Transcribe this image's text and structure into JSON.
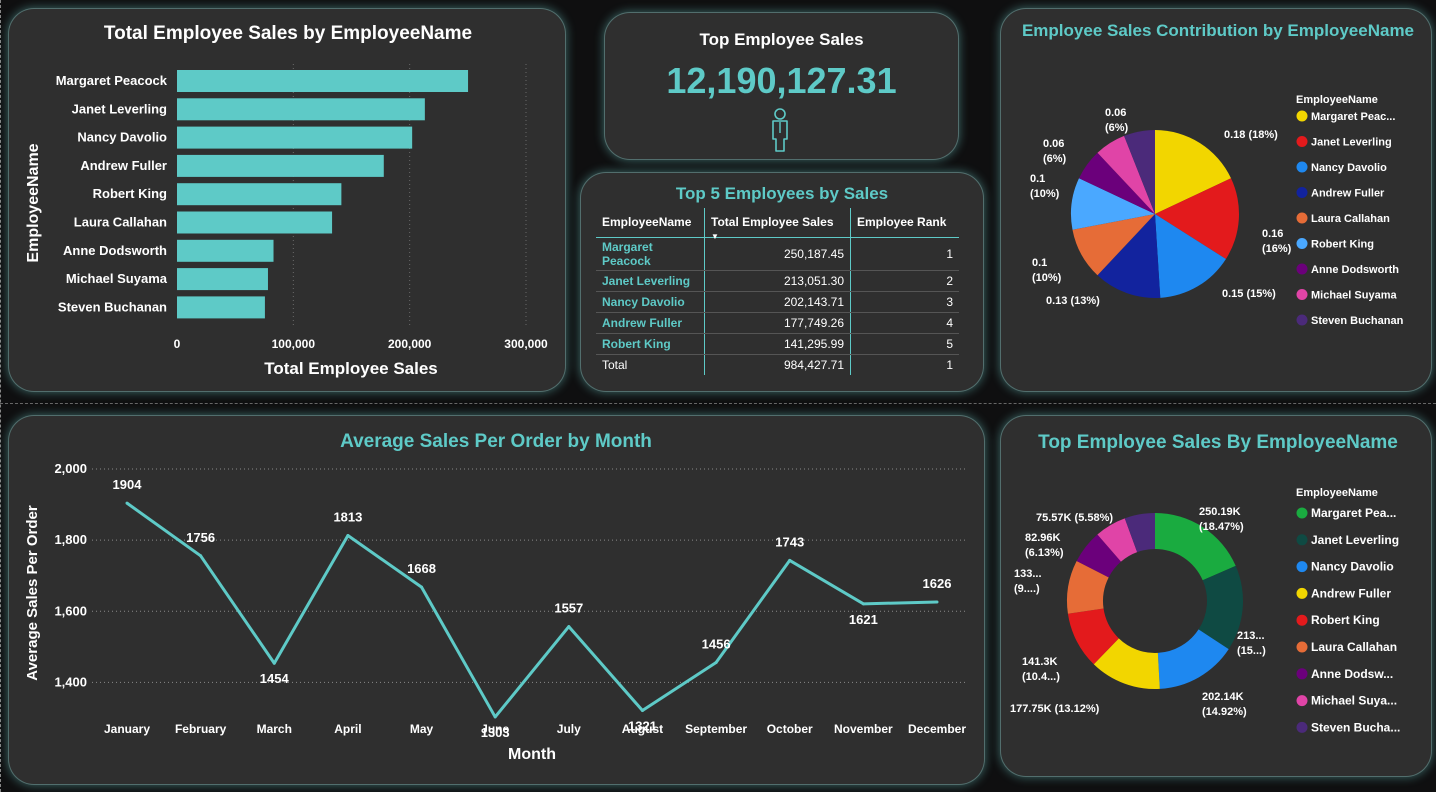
{
  "bar_card": {
    "title": "Total Employee Sales by EmployeeName",
    "xlabel": "Total Employee Sales",
    "ylabel": "EmployeeName"
  },
  "kpi_card": {
    "title": "Top Employee Sales",
    "value": "12,190,127.31",
    "icon": "person-icon"
  },
  "table_card": {
    "title": "Top 5 Employees by Sales",
    "columns": [
      "EmployeeName",
      "Total Employee Sales",
      "Employee Rank"
    ],
    "rows": [
      [
        "Margaret Peacock",
        "250,187.45",
        "1"
      ],
      [
        "Janet Leverling",
        "213,051.30",
        "2"
      ],
      [
        "Nancy Davolio",
        "202,143.71",
        "3"
      ],
      [
        "Andrew Fuller",
        "177,749.26",
        "4"
      ],
      [
        "Robert King",
        "141,295.99",
        "5"
      ]
    ],
    "total_row": [
      "Total",
      "984,427.71",
      "1"
    ]
  },
  "pie_card": {
    "title": "Employee Sales Contribution by EmployeeName",
    "legend_title": "EmployeeName"
  },
  "line_card": {
    "title": "Average Sales Per Order by Month",
    "xlabel": "Month",
    "ylabel": "Average Sales Per Order"
  },
  "donut_card": {
    "title": "Top Employee Sales By EmployeeName",
    "legend_title": "EmployeeName"
  },
  "chart_data": [
    {
      "type": "bar",
      "orientation": "horizontal",
      "title": "Total Employee Sales by EmployeeName",
      "xlabel": "Total Employee Sales",
      "ylabel": "EmployeeName",
      "categories": [
        "Margaret Peacock",
        "Janet Leverling",
        "Nancy Davolio",
        "Andrew Fuller",
        "Robert King",
        "Laura Callahan",
        "Anne Dodsworth",
        "Michael Suyama",
        "Steven Buchanan"
      ],
      "values": [
        250187,
        213051,
        202144,
        177749,
        141296,
        133301,
        82964,
        78198,
        75568
      ],
      "xlim": [
        0,
        300000
      ],
      "ticks": [
        "0",
        "100,000",
        "200,000",
        "300,000"
      ],
      "color": "#5ecac7",
      "grid": true
    },
    {
      "type": "pie",
      "title": "Employee Sales Contribution by EmployeeName",
      "legend_title": "EmployeeName",
      "legend": [
        "Margaret Peac...",
        "Janet Leverling",
        "Nancy Davolio",
        "Andrew Fuller",
        "Laura Callahan",
        "Robert King",
        "Anne Dodsworth",
        "Michael Suyama",
        "Steven Buchanan"
      ],
      "values": [
        0.18,
        0.16,
        0.15,
        0.13,
        0.1,
        0.1,
        0.06,
        0.06,
        0.06
      ],
      "colors": [
        "#f2d600",
        "#e31a1c",
        "#1e88f0",
        "#12239e",
        "#e66c37",
        "#4aa8ff",
        "#6b007b",
        "#e044a7",
        "#4b2a7a"
      ],
      "labels": [
        "0.18 (18%)",
        "0.16 (16%)",
        "0.15 (15%)",
        "0.13 (13%)",
        "0.1 (10%)",
        "0.1 (10%)",
        "0.06 (6%)",
        "0.06 (6%)",
        "0.06 (6%)"
      ]
    },
    {
      "type": "line",
      "title": "Average Sales Per Order by Month",
      "xlabel": "Month",
      "ylabel": "Average Sales Per Order",
      "categories": [
        "January",
        "February",
        "March",
        "April",
        "May",
        "June",
        "July",
        "August",
        "September",
        "October",
        "November",
        "December"
      ],
      "values": [
        1904,
        1756,
        1454,
        1813,
        1668,
        1303,
        1557,
        1321,
        1456,
        1743,
        1621,
        1626
      ],
      "ylim": [
        1300,
        2000
      ],
      "yticks": [
        "1,400",
        "1,600",
        "1,800",
        "2,000"
      ],
      "color": "#5ecac7",
      "grid": true
    },
    {
      "type": "pie",
      "subtype": "donut",
      "title": "Top Employee Sales By EmployeeName",
      "legend_title": "EmployeeName",
      "legend": [
        "Margaret Pea...",
        "Janet Leverling",
        "Nancy Davolio",
        "Andrew Fuller",
        "Robert King",
        "Laura Callahan",
        "Anne Dodsw...",
        "Michael Suya...",
        "Steven Bucha..."
      ],
      "values": [
        250190,
        213050,
        202140,
        177750,
        141300,
        133300,
        82960,
        78200,
        75570
      ],
      "colors": [
        "#1aab40",
        "#0f4a43",
        "#1e88f0",
        "#f2d600",
        "#e31a1c",
        "#e66c37",
        "#6b007b",
        "#e044a7",
        "#4b2a7a"
      ],
      "label_lines": [
        [
          "250.19K",
          "(18.47%)"
        ],
        [
          "213...",
          "(15...)"
        ],
        [
          "202.14K",
          "(14.92%)"
        ],
        [
          "177.75K (13.12%)"
        ],
        [
          "141.3K",
          "(10.4...)"
        ],
        [
          "133...",
          "(9....)"
        ],
        [
          "82.96K",
          "(6.13%)"
        ],
        [
          "75.57K (5.58%)"
        ],
        []
      ]
    }
  ]
}
